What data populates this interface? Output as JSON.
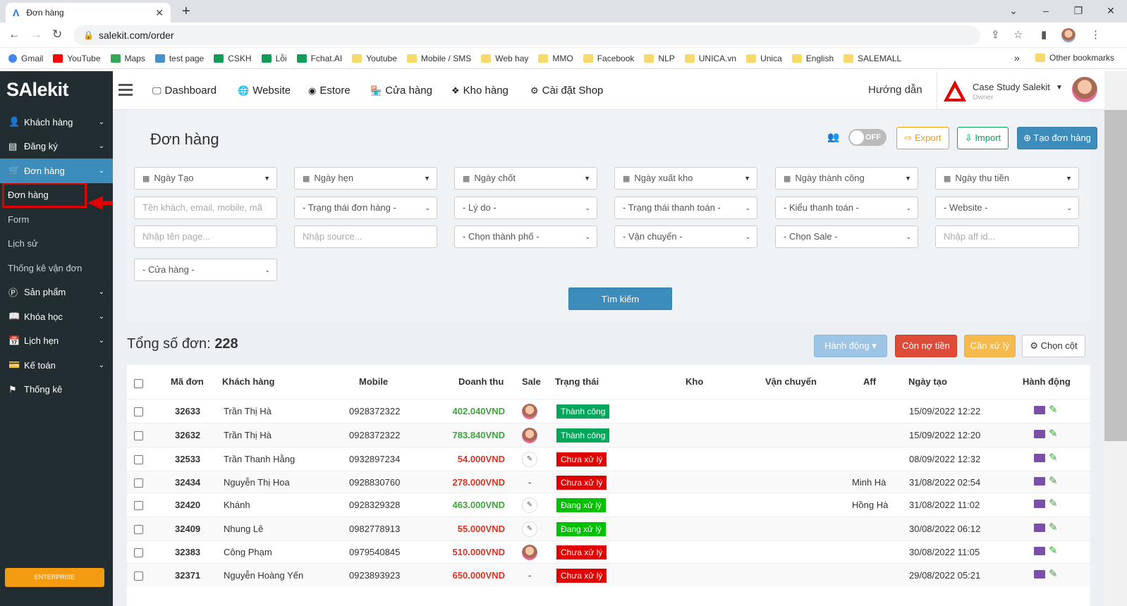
{
  "browser": {
    "tab_title": "Đơn hàng",
    "url": "salekit.com/order",
    "bookmarks": [
      "Gmail",
      "YouTube",
      "Maps",
      "test page",
      "CSKH",
      "Lỗi",
      "Fchat.AI",
      "Youtube",
      "Mobile / SMS",
      "Web hay",
      "MMO",
      "Facebook",
      "NLP",
      "UNICA.vn",
      "Unica",
      "English",
      "SALEMALL"
    ],
    "more": "»",
    "other_bookmarks": "Other bookmarks"
  },
  "sidebar": {
    "logo": "SAlekit",
    "items": [
      {
        "label": "Khách hàng",
        "icon": "user-icon",
        "glyph": "👤"
      },
      {
        "label": "Đăng ký",
        "icon": "list-icon",
        "glyph": "▤"
      }
    ],
    "active": {
      "label": "Đơn hàng",
      "icon": "cart-icon",
      "glyph": "🛒"
    },
    "subitems": [
      "Đơn hàng",
      "Form",
      "Lịch sử",
      "Thống kê vận đơn"
    ],
    "items2": [
      {
        "label": "Sản phẩm",
        "icon": "product-icon",
        "glyph": "Ⓟ"
      },
      {
        "label": "Khóa học",
        "icon": "book-icon",
        "glyph": "📖"
      },
      {
        "label": "Lịch hẹn",
        "icon": "calendar-icon",
        "glyph": "📅"
      },
      {
        "label": "Kế toán",
        "icon": "card-icon",
        "glyph": "💳"
      },
      {
        "label": "Thống kê",
        "icon": "flag-icon",
        "glyph": "⚑"
      }
    ],
    "enterprise": "ENTERPRISE"
  },
  "topnav": {
    "items": [
      {
        "label": "Dashboard",
        "icon": "monitor-icon",
        "glyph": "🖵"
      },
      {
        "label": "Website",
        "icon": "globe-icon",
        "glyph": "🌐"
      },
      {
        "label": "Estore",
        "icon": "compass-icon",
        "glyph": "◉"
      },
      {
        "label": "Cửa hàng",
        "icon": "store-icon",
        "glyph": "🏪"
      },
      {
        "label": "Kho hàng",
        "icon": "layers-icon",
        "glyph": "❖"
      },
      {
        "label": "Cài đặt Shop",
        "icon": "gear-icon",
        "glyph": "⚙"
      }
    ],
    "guide": "Hướng dẫn",
    "user_name": "Case Study Salekit",
    "user_role": "Owner"
  },
  "page": {
    "title": "Đơn hàng",
    "toggle": "OFF",
    "export": "Export",
    "import": "Import",
    "create": "Tạo đơn hàng",
    "search_button": "Tìm kiếm"
  },
  "filters": {
    "dates": [
      "Ngày Tạo",
      "Ngày hẹn",
      "Ngày chốt",
      "Ngày xuất kho",
      "Ngày thành công",
      "Ngày thu tiền"
    ],
    "row2_placeholder": "Tên khách, email, mobile, mã",
    "row2_selects": [
      "- Trạng thái đơn hàng -",
      "- Lý do -",
      "- Trạng thái thanh toán -",
      "- Kiểu thanh toán -",
      "- Website -"
    ],
    "row3_page": "Nhập tên page...",
    "row3_source": "Nhập source...",
    "row3_selects": [
      "- Chọn thành phố -",
      "- Vận chuyển -",
      "- Chọn Sale -"
    ],
    "row3_aff": "Nhập aff id...",
    "row4_store": "- Cửa hàng -"
  },
  "summary": {
    "label": "Tổng số đơn:",
    "count": "228",
    "action": "Hành động",
    "debt": "Còn nợ tiền",
    "process": "Cần xử lý",
    "columns": "Chọn cột"
  },
  "table": {
    "headers": [
      "Mã đơn",
      "Khách hàng",
      "Mobile",
      "Doanh thu",
      "Sale",
      "Trạng thái",
      "Kho",
      "Vận chuyển",
      "Aff",
      "Ngày tạo",
      "Hành động"
    ],
    "rows": [
      {
        "id": "32633",
        "customer": "Trần Thị Hà",
        "mobile": "0928372322",
        "revenue": "402.040VND",
        "rev_color": "green",
        "sale": "photo",
        "status": "Thành công",
        "status_type": "ok",
        "aff": "",
        "date": "15/09/2022 12:22"
      },
      {
        "id": "32632",
        "customer": "Trần Thị Hà",
        "mobile": "0928372322",
        "revenue": "783.840VND",
        "rev_color": "green",
        "sale": "photo",
        "status": "Thành công",
        "status_type": "ok",
        "aff": "",
        "date": "15/09/2022 12:20"
      },
      {
        "id": "32533",
        "customer": "Trần Thanh Hằng",
        "mobile": "0932897234",
        "revenue": "54.000VND",
        "rev_color": "red",
        "sale": "sketch",
        "status": "Chưa xử lý",
        "status_type": "no",
        "aff": "",
        "date": "08/09/2022 12:32"
      },
      {
        "id": "32434",
        "customer": "Nguyễn Thị Hoa",
        "mobile": "0928830760",
        "revenue": "278.000VND",
        "rev_color": "red",
        "sale": "-",
        "status": "Chưa xử lý",
        "status_type": "no",
        "aff": "Minh Hà",
        "date": "31/08/2022 02:54"
      },
      {
        "id": "32420",
        "customer": "Khánh",
        "mobile": "0928329328",
        "revenue": "463.000VND",
        "rev_color": "green",
        "sale": "sketch",
        "status": "Đang xử lý",
        "status_type": "ip",
        "aff": "Hồng Hà",
        "date": "31/08/2022 11:02"
      },
      {
        "id": "32409",
        "customer": "Nhung Lê",
        "mobile": "0982778913",
        "revenue": "55.000VND",
        "rev_color": "red",
        "sale": "sketch",
        "status": "Đang xử lý",
        "status_type": "ip",
        "aff": "",
        "date": "30/08/2022 06:12"
      },
      {
        "id": "32383",
        "customer": "Công Phạm",
        "mobile": "0979540845",
        "revenue": "510.000VND",
        "rev_color": "red",
        "sale": "photo",
        "status": "Chưa xử lý",
        "status_type": "no",
        "aff": "",
        "date": "30/08/2022 11:05"
      },
      {
        "id": "32371",
        "customer": "Nguyễn Hoàng Yến",
        "mobile": "0923893923",
        "revenue": "650.000VND",
        "rev_color": "red",
        "sale": "-",
        "status": "Chưa xử lý",
        "status_type": "no",
        "aff": "",
        "date": "29/08/2022 05:21"
      }
    ]
  },
  "colors": {
    "sidebar": "#222d32",
    "active": "#3c8dbc",
    "highlight": "#e00000",
    "success": "#00a65a",
    "danger": "#dd4b39",
    "warning": "#f39c12"
  }
}
